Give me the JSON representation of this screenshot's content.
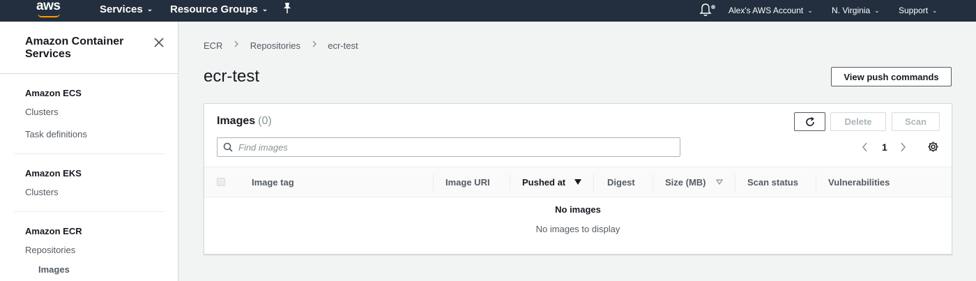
{
  "topnav": {
    "logo_text": "aws",
    "services_label": "Services",
    "resource_groups_label": "Resource Groups",
    "account_label": "Alex's AWS Account",
    "region_label": "N. Virginia",
    "support_label": "Support",
    "background_color": "#232f3e",
    "accent_color": "#ff9900"
  },
  "sidebar": {
    "title": "Amazon Container Services",
    "sections": [
      {
        "heading": "Amazon ECS",
        "items": [
          "Clusters",
          "Task definitions"
        ]
      },
      {
        "heading": "Amazon EKS",
        "items": [
          "Clusters"
        ]
      },
      {
        "heading": "Amazon ECR",
        "items": [
          "Repositories"
        ],
        "subitems": [
          "Images"
        ]
      }
    ]
  },
  "breadcrumb": [
    "ECR",
    "Repositories",
    "ecr-test"
  ],
  "page": {
    "title": "ecr-test",
    "view_push_commands_label": "View push commands"
  },
  "images_panel": {
    "title": "Images",
    "count": "(0)",
    "delete_label": "Delete",
    "scan_label": "Scan",
    "search_placeholder": "Find images",
    "current_page": "1",
    "columns": [
      "Image tag",
      "Image URI",
      "Pushed at",
      "Digest",
      "Size (MB)",
      "Scan status",
      "Vulnerabilities"
    ],
    "empty_title": "No images",
    "empty_message": "No images to display"
  },
  "icons": [
    "pin-icon",
    "bell-icon",
    "close-icon",
    "refresh-icon",
    "search-icon",
    "chevron-left-icon",
    "chevron-right-icon",
    "gear-icon",
    "sort-desc-icon",
    "sort-icon"
  ]
}
